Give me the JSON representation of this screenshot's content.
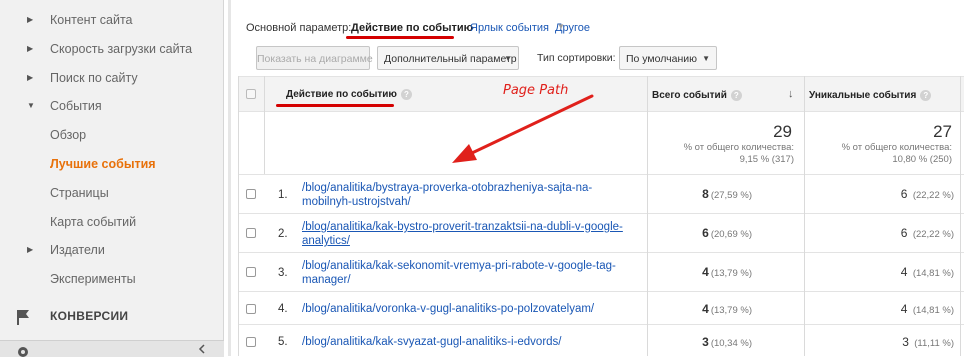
{
  "sidebar": {
    "items": [
      {
        "label": "Контент сайта",
        "arrow": "▶"
      },
      {
        "label": "Скорость загрузки сайта",
        "arrow": "▶"
      },
      {
        "label": "Поиск по сайту",
        "arrow": "▶"
      },
      {
        "label": "События",
        "arrow": "▼"
      },
      {
        "label": "Обзор",
        "arrow": ""
      },
      {
        "label": "Лучшие события",
        "arrow": ""
      },
      {
        "label": "Страницы",
        "arrow": ""
      },
      {
        "label": "Карта событий",
        "arrow": ""
      },
      {
        "label": "Издатели",
        "arrow": "▶"
      },
      {
        "label": "Эксперименты",
        "arrow": ""
      }
    ],
    "active_index": 5,
    "conversions_label": "КОНВЕРСИИ"
  },
  "dimension_bar": {
    "prefix": "Основной параметр:",
    "current": "Действие по событию",
    "option_label": "Ярлык события",
    "other": "Другое"
  },
  "controls": {
    "chart_button": "Показать на диаграмме",
    "secondary_button": "Дополнительный параметр",
    "sort_label": "Тип сортировки:",
    "sort_value": "По умолчанию"
  },
  "table": {
    "columns": {
      "action": "Действие по событию",
      "total": "Всего событий",
      "unique": "Уникальные события"
    },
    "totals": {
      "total": "29",
      "total_pct_label": "% от общего количества:",
      "total_pct": "9,15 % (317)",
      "unique": "27",
      "unique_pct_label": "% от общего количества:",
      "unique_pct": "10,80 % (250)"
    },
    "rows": [
      {
        "idx": "1.",
        "path": "/blog/analitika/bystraya-proverka-otobrazheniya-sajta-na-mobilnyh-ustrojstvah/",
        "total": "8",
        "total_pct": "(27,59 %)",
        "unique": "6",
        "unique_pct": "(22,22 %)"
      },
      {
        "idx": "2.",
        "path": "/blog/analitika/kak-bystro-proverit-tranzaktsii-na-dubli-v-google-analytics/",
        "total": "6",
        "total_pct": "(20,69 %)",
        "unique": "6",
        "unique_pct": "(22,22 %)"
      },
      {
        "idx": "3.",
        "path": "/blog/analitika/kak-sekonomit-vremya-pri-rabote-v-google-tag-manager/",
        "total": "4",
        "total_pct": "(13,79 %)",
        "unique": "4",
        "unique_pct": "(14,81 %)"
      },
      {
        "idx": "4.",
        "path": "/blog/analitika/voronka-v-gugl-analitiks-po-polzovatelyam/",
        "total": "4",
        "total_pct": "(13,79 %)",
        "unique": "4",
        "unique_pct": "(14,81 %)"
      },
      {
        "idx": "5.",
        "path": "/blog/analitika/kak-svyazat-gugl-analitiks-i-edvords/",
        "total": "3",
        "total_pct": "(10,34 %)",
        "unique": "3",
        "unique_pct": "(11,11 %)"
      }
    ]
  },
  "annotation": {
    "label": "Page Path",
    "color": "#e0201b"
  },
  "colors": {
    "link": "#1a57b5",
    "active_nav": "#e8710a",
    "highlight": "#d40000"
  }
}
